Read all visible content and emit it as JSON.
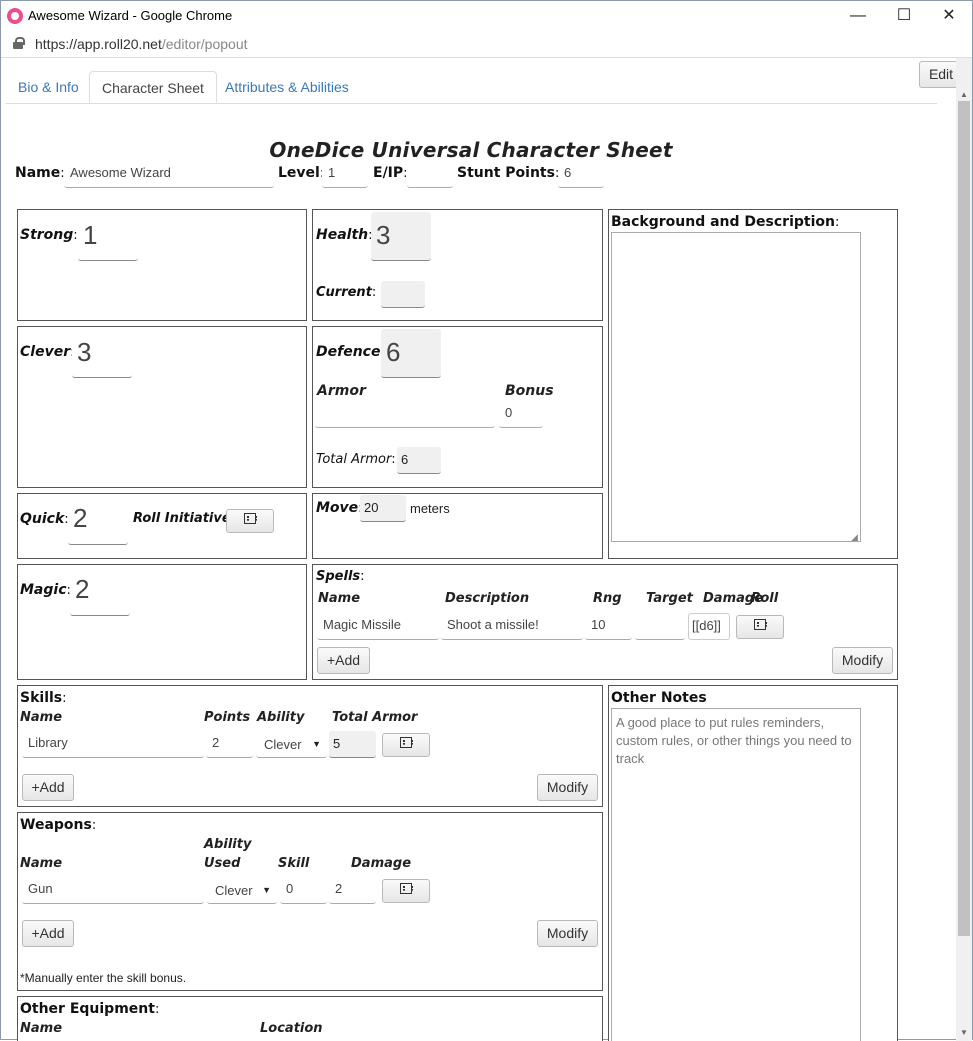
{
  "window": {
    "title": "Awesome Wizard - Google Chrome",
    "minimize": "—",
    "maximize": "☐",
    "close": "✕"
  },
  "address": {
    "url_main": "https://app.roll20.net",
    "url_path": "/editor/popout"
  },
  "tabs": [
    {
      "label": "Bio & Info"
    },
    {
      "label": "Character Sheet"
    },
    {
      "label": "Attributes & Abilities"
    }
  ],
  "edit_button": "Edit",
  "sheet": {
    "title": "OneDice Universal Character Sheet",
    "name_label": "Name",
    "name_value": "Awesome Wizard",
    "level_label": "Level",
    "level_value": "1",
    "ep_label": "E/IP",
    "ep_value": "",
    "stunt_label": "Stunt Points",
    "stunt_value": "6",
    "strong_label": "Strong",
    "strong_value": "1",
    "health_label": "Health",
    "health_value": "3",
    "current_label": "Current",
    "current_value": "",
    "clever_label": "Clever",
    "clever_value": "3",
    "defence_label": "Defence",
    "defence_value": "6",
    "armor_label": "Armor",
    "bonus_label": "Bonus",
    "armor_value": "",
    "bonus_value": "0",
    "total_armor_label": "Total Armor",
    "total_armor_value": "6",
    "quick_label": "Quick",
    "quick_value": "2",
    "roll_init_label": "Roll Initiative",
    "move_label": "Move",
    "move_value": "20",
    "move_unit": "meters",
    "magic_label": "Magic",
    "magic_value": "2",
    "background_label": "Background and Description",
    "spells": {
      "label": "Spells",
      "headers": [
        "Name",
        "Description",
        "Rng",
        "Target",
        "Damage",
        "Roll"
      ],
      "row": {
        "name": "Magic Missile",
        "description": "Shoot a missile!",
        "rng": "10",
        "target": "",
        "damage": "[[d6]]"
      },
      "add": "+Add",
      "modify": "Modify"
    },
    "skills": {
      "label": "Skills",
      "headers": [
        "Name",
        "Points",
        "Ability",
        "Total Armor"
      ],
      "row": {
        "name": "Library",
        "points": "2",
        "ability": "Clever",
        "total": "5"
      },
      "add": "+Add",
      "modify": "Modify"
    },
    "other_notes": {
      "label": "Other Notes",
      "placeholder": "A good place to put rules reminders, custom rules, or other things you need to track"
    },
    "weapons": {
      "label": "Weapons",
      "headers": [
        "Name",
        "Ability Used",
        "Skill",
        "Damage"
      ],
      "header_ability_line1": "Ability",
      "header_ability_line2": "Used",
      "row": {
        "name": "Gun",
        "ability": "Clever",
        "skill": "0",
        "damage": "2"
      },
      "add": "+Add",
      "modify": "Modify",
      "note": "*Manually enter the skill bonus."
    },
    "equipment": {
      "label": "Other Equipment",
      "headers": [
        "Name",
        "Location"
      ]
    }
  }
}
